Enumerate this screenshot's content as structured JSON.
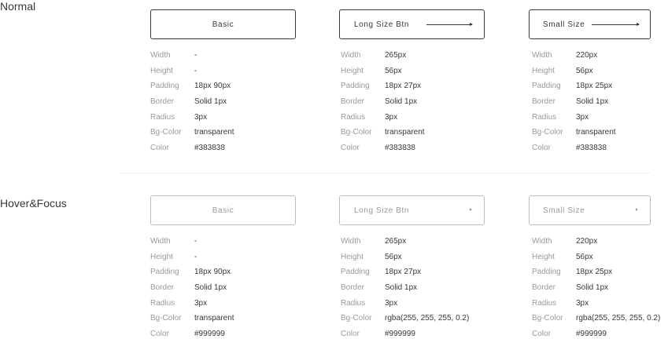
{
  "sections": {
    "normal_title": "Normal",
    "hover_title": "Hover&Focus"
  },
  "labels": [
    "Width",
    "Height",
    "Padding",
    "Border",
    "Radius",
    "Bg-Color",
    "Color"
  ],
  "normal": {
    "basic": {
      "label": "Basic",
      "values": [
        "-",
        "-",
        "18px 90px",
        "Solid 1px",
        "3px",
        "transparent",
        "#383838"
      ]
    },
    "long": {
      "label": "Long Size Btn",
      "values": [
        "265px",
        "56px",
        "18px 27px",
        "Solid 1px",
        "3px",
        "transparent",
        "#383838"
      ]
    },
    "small": {
      "label": "Small Size",
      "values": [
        "220px",
        "56px",
        "18px 25px",
        "Solid 1px",
        "3px",
        "transparent",
        "#383838"
      ]
    }
  },
  "hover": {
    "basic": {
      "label": "Basic",
      "values": [
        "-",
        "-",
        "18px 90px",
        "Solid 1px",
        "3px",
        "transparent",
        "#999999"
      ]
    },
    "long": {
      "label": "Long Size Btn",
      "values": [
        "265px",
        "56px",
        "18px 27px",
        "Solid 1px",
        "3px",
        "rgba(255, 255, 255, 0.2)",
        "#999999"
      ]
    },
    "small": {
      "label": "Small Size",
      "values": [
        "220px",
        "56px",
        "18px 25px",
        "Solid 1px",
        "3px",
        "rgba(255, 255, 255, 0.2)",
        "#999999"
      ]
    }
  },
  "colors": {
    "text": "#383838",
    "muted": "#999999",
    "label": "#9a9a9a",
    "divider": "#f0f0f0"
  },
  "icons": {
    "normal_long": "long-arrow-right-icon",
    "normal_small": "long-arrow-right-icon",
    "hover_long": "small-triangle-right-icon",
    "hover_small": "small-triangle-right-icon"
  }
}
